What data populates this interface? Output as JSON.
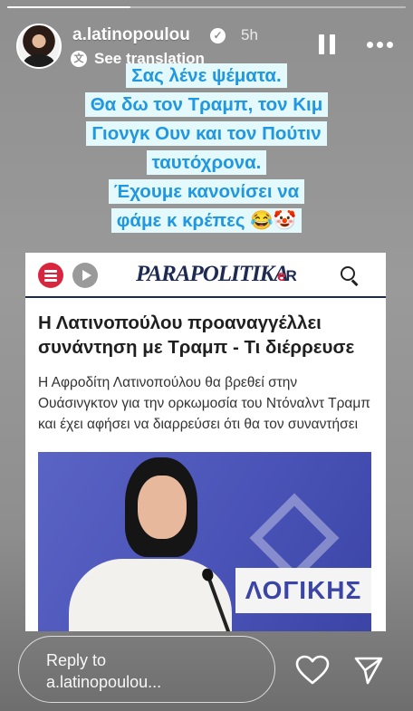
{
  "story": {
    "progress_fraction": 0.31
  },
  "header": {
    "username": "a.latinopoulou",
    "verified_icon": "verified-check-icon",
    "time_ago": "5h",
    "see_translation": "See translation",
    "translate_icon": "translate-icon",
    "pause_icon": "pause-icon",
    "more_icon": "more-options-icon"
  },
  "caption": {
    "lines": [
      "Σας λένε ψέματα.",
      "Θα δω τον Τραμπ, τον Κιμ",
      "Γιονγκ Ουν και τον Πούτιν",
      "ταυτόχρονα.",
      "Έχουμε κανονίσει να",
      "φάμε κ κρέπες 😂🤡"
    ],
    "text_color": "#2097e0",
    "highlight_color": "#e3f9fb"
  },
  "article": {
    "site_logo": "PARAPOLITIKA",
    "site_logo_badge_1": "e",
    "site_logo_badge_2": "R",
    "brand_color": "#1d2a52",
    "accent_color": "#d7263d",
    "headline": "Η Λατινοπούλου προαναγγέλλει συνάντηση με Τραμπ - Τι διέρρευσε",
    "lead": "Η Αφροδίτη Λατινοπούλου θα βρεθεί στην Ουάσινγκτον για την ορκωμοσία του Ντόναλντ Τραμπ και έχει αφήσει να διαρρεύσει ότι θα τον συναντήσει",
    "photo_banner_text": "ΛΟΓΙΚΗΣ"
  },
  "footer": {
    "reply_placeholder_line1": "Reply to",
    "reply_placeholder_line2": "a.latinopoulou...",
    "like_icon": "heart-icon",
    "share_icon": "send-icon"
  }
}
